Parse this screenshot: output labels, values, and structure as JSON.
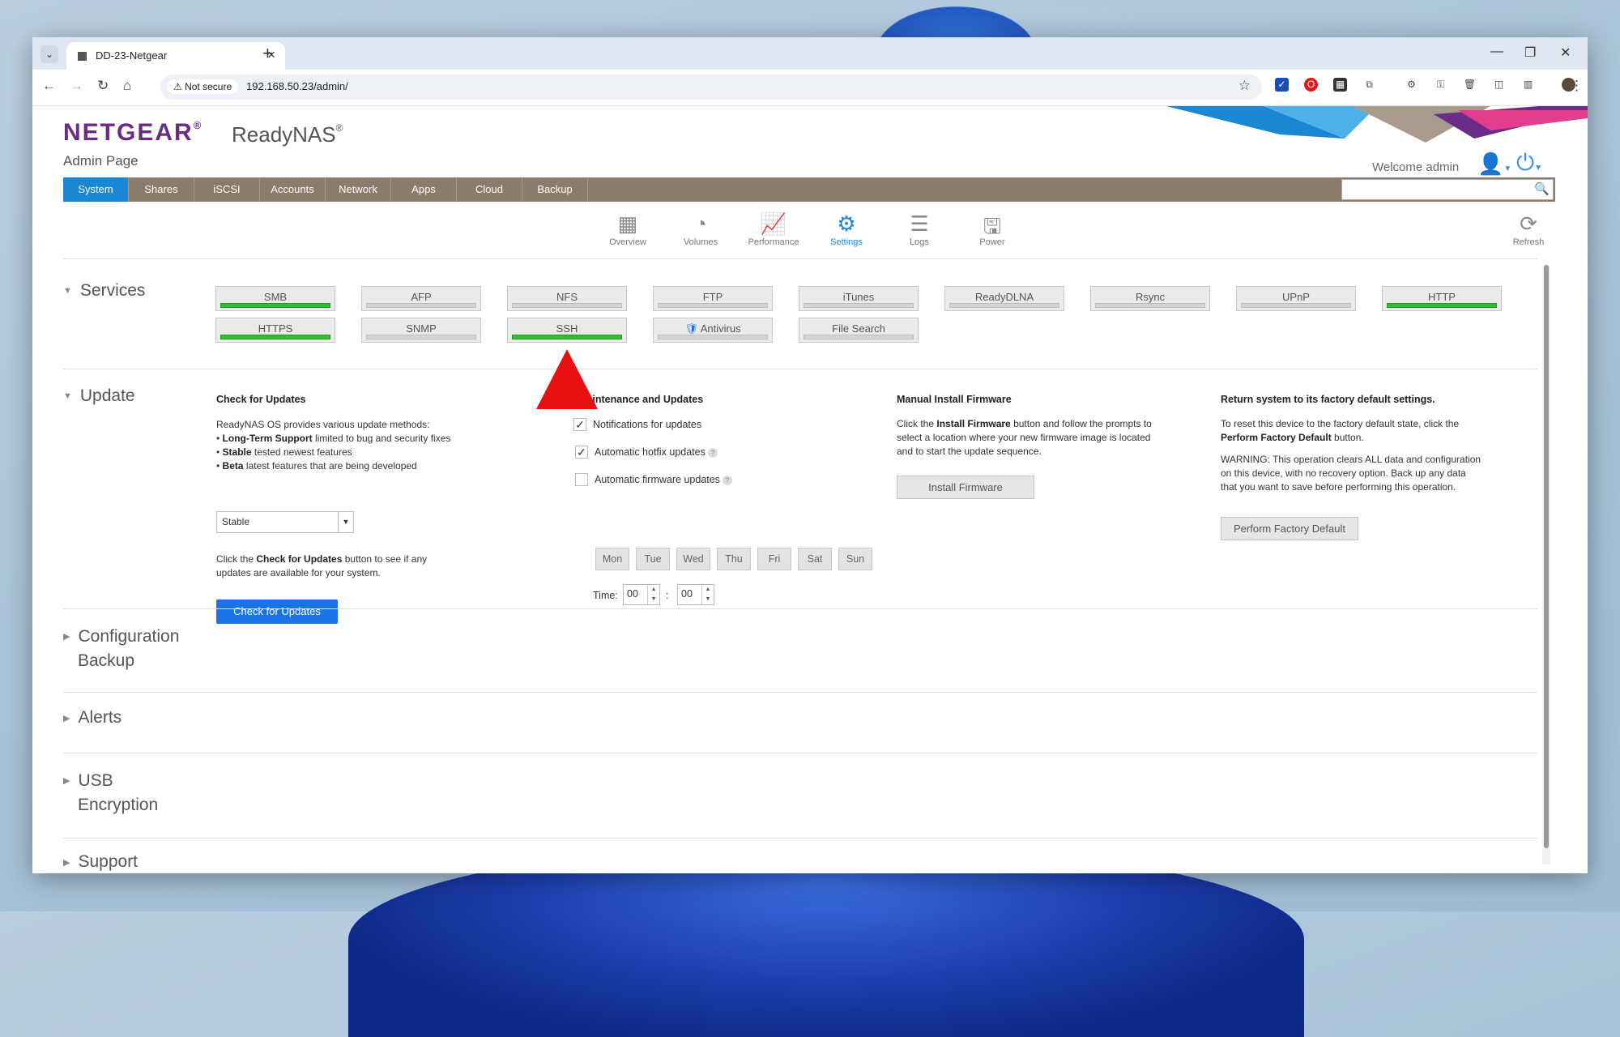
{
  "browser": {
    "tab_title": "DD-23-Netgear",
    "not_secure": "Not secure",
    "url": "192.168.50.23/admin/"
  },
  "header": {
    "logo": "NETGEAR",
    "logo_mark": "®",
    "product": "ReadyNAS",
    "product_mark": "®",
    "admin_page": "Admin Page",
    "welcome": "Welcome admin"
  },
  "nav": {
    "tabs": [
      "System",
      "Shares",
      "iSCSI",
      "Accounts",
      "Network",
      "Apps",
      "Cloud",
      "Backup"
    ],
    "active": "System"
  },
  "subnav": {
    "items": [
      "Overview",
      "Volumes",
      "Performance",
      "Settings",
      "Logs",
      "Power"
    ],
    "active": "Settings",
    "refresh": "Refresh"
  },
  "services": {
    "title": "Services",
    "items": [
      {
        "label": "SMB",
        "on": true
      },
      {
        "label": "AFP",
        "on": false
      },
      {
        "label": "NFS",
        "on": false
      },
      {
        "label": "FTP",
        "on": false
      },
      {
        "label": "iTunes",
        "on": false
      },
      {
        "label": "ReadyDLNA",
        "on": false
      },
      {
        "label": "Rsync",
        "on": false
      },
      {
        "label": "UPnP",
        "on": false
      },
      {
        "label": "HTTP",
        "on": true
      },
      {
        "label": "HTTPS",
        "on": true
      },
      {
        "label": "SNMP",
        "on": false
      },
      {
        "label": "SSH",
        "on": true
      },
      {
        "label": "Antivirus",
        "on": false
      },
      {
        "label": "File Search",
        "on": false
      }
    ]
  },
  "update": {
    "title": "Update",
    "check": {
      "heading": "Check for Updates",
      "intro": "ReadyNAS OS provides various update methods:",
      "lts_b": "Long-Term Support",
      "lts_t": " limited to bug and security fixes",
      "stable_b": "Stable",
      "stable_t": " tested newest features",
      "beta_b": "Beta",
      "beta_t": " latest features that are being developed",
      "select_value": "Stable",
      "note_a": "Click the ",
      "note_b": "Check for Updates",
      "note_c": " button to see if any",
      "note_d": "updates are available for your system.",
      "button": "Check for Updates"
    },
    "maintenance": {
      "heading": "Maintenance and Updates",
      "notifications": "Notifications for updates",
      "hotfix": "Automatic hotfix updates",
      "firmware": "Automatic firmware updates",
      "days": [
        "Mon",
        "Tue",
        "Wed",
        "Thu",
        "Fri",
        "Sat",
        "Sun"
      ],
      "time_label": "Time:",
      "hour": "00",
      "minute": "00",
      "colon": ":"
    },
    "manual": {
      "heading": "Manual Install Firmware",
      "l1a": "Click the ",
      "l1b": "Install Firmware",
      "l1c": " button and follow the prompts to",
      "l2": "select a location where your new firmware image is located",
      "l3": "and to start the update sequence.",
      "button": "Install Firmware"
    },
    "factory": {
      "heading": "Return system to its factory default settings.",
      "l1": "To reset this device to the factory default state, click the",
      "l2b": "Perform Factory Default",
      "l2c": " button.",
      "w1": "WARNING: This operation clears ALL data and configuration",
      "w2": "on this device, with no recovery option. Back up any data",
      "w3": "that you want to save before performing this operation.",
      "button": "Perform Factory Default"
    }
  },
  "sections": {
    "config_1": "Configuration",
    "config_2": "Backup",
    "alerts": "Alerts",
    "usb_1": "USB",
    "usb_2": "Encryption",
    "support": "Support"
  },
  "colors": {
    "netgear_purple": "#6a2c86",
    "accent_blue": "#1a87d5",
    "nav_brown": "#8b7b6a",
    "service_on": "#2dbf2d",
    "annotation_red": "#e81010"
  }
}
